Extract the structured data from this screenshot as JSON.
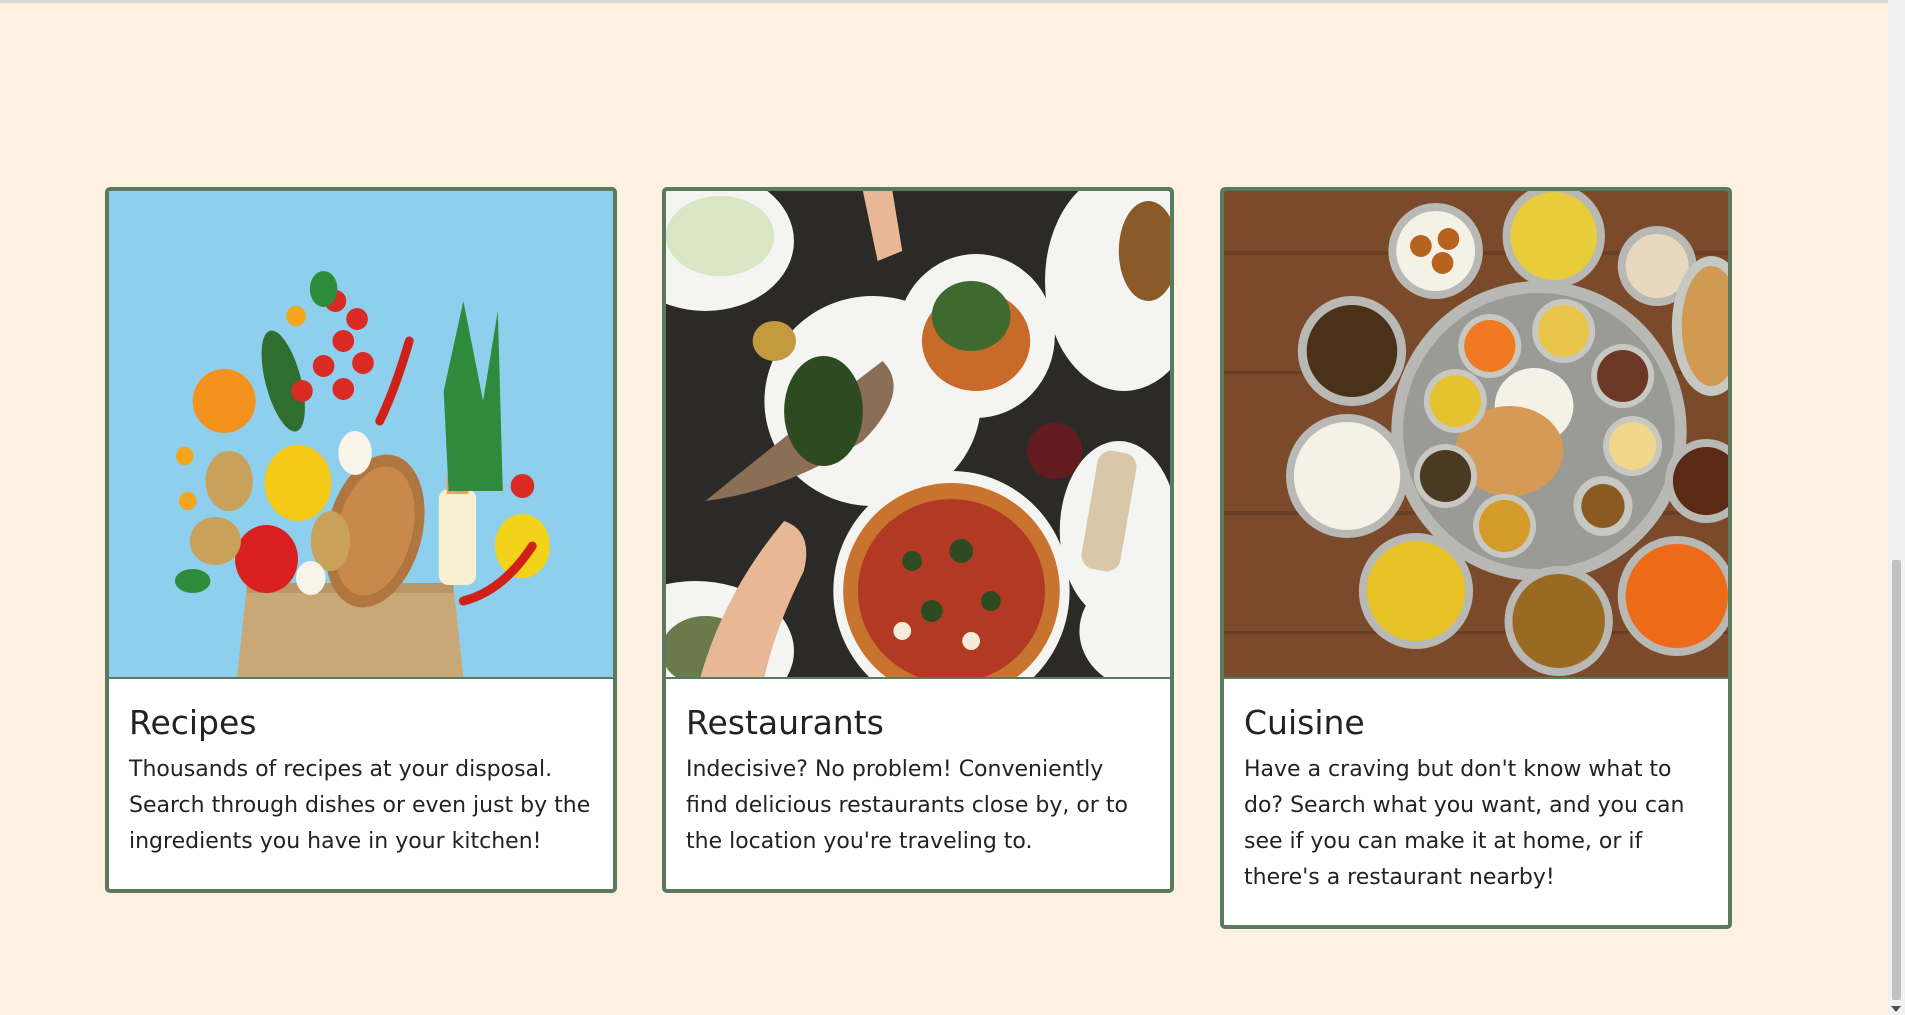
{
  "cards": [
    {
      "title": "Recipes",
      "text": "Thousands of recipes at your disposal. Search through dishes or even just by the ingredients you have in your kitchen!"
    },
    {
      "title": "Restaurants",
      "text": "Indecisive? No problem! Conveniently find delicious restaurants close by, or to the location you're traveling to."
    },
    {
      "title": "Cuisine",
      "text": "Have a craving but don't know what to do? Search what you want, and you can see if you can make it at home, or if there's a restaurant nearby!"
    }
  ],
  "colors": {
    "page_background": "#fff1e2",
    "card_border": "#5a7a5f",
    "text": "#222222"
  }
}
